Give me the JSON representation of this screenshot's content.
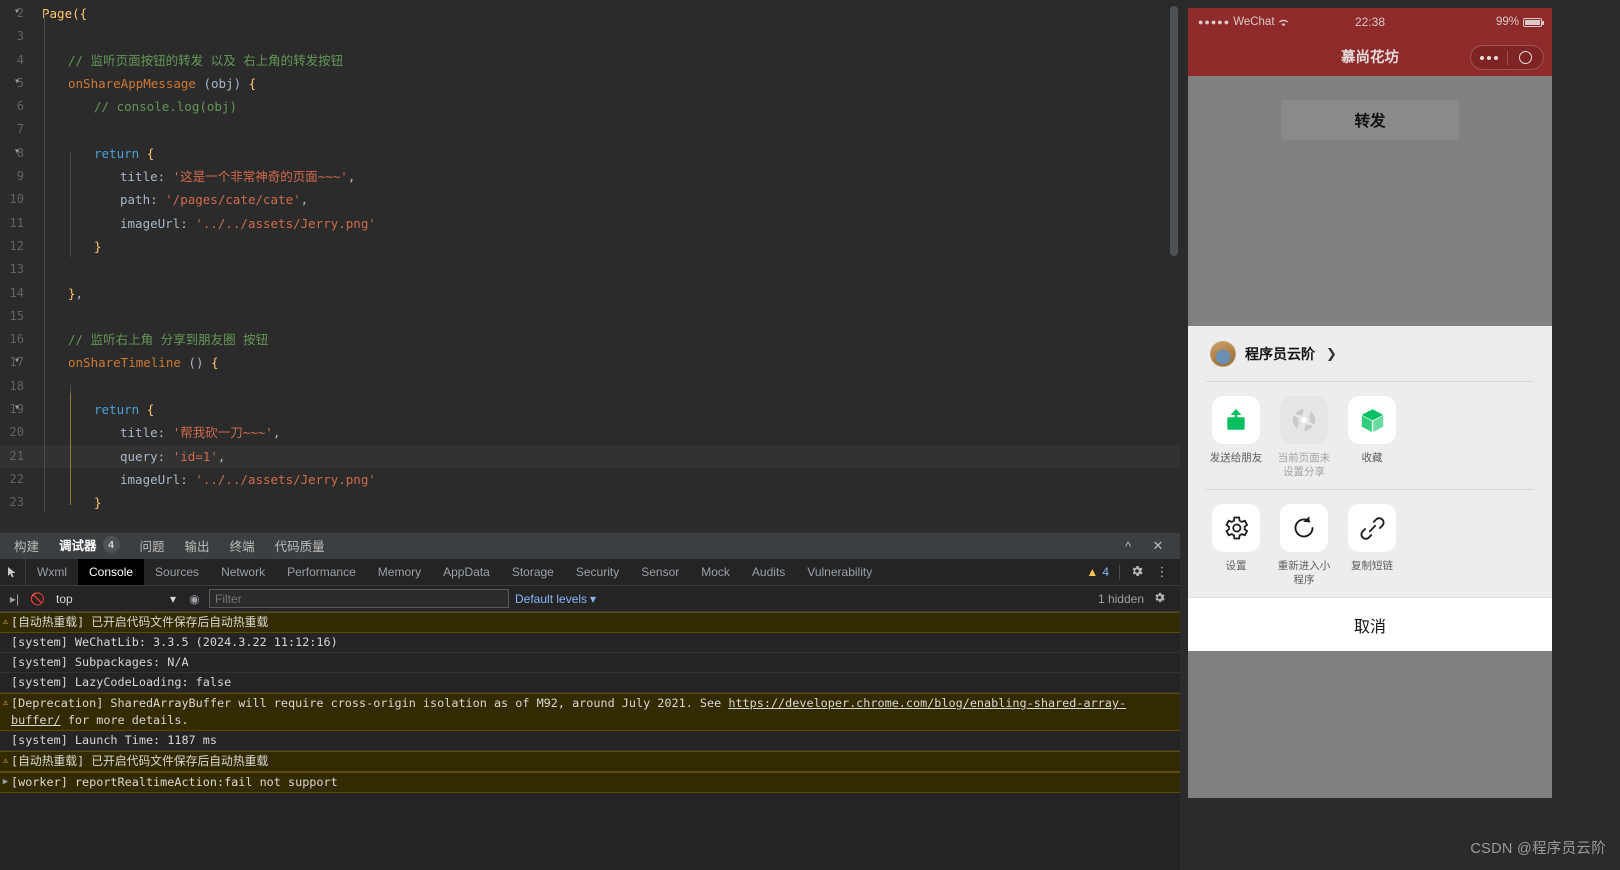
{
  "editor": {
    "lines": [
      {
        "num": "2",
        "fold": true,
        "indent": 0,
        "tokens": [
          {
            "t": "Page",
            "c": "k-fn"
          },
          {
            "t": "(",
            "c": "k-brace"
          },
          {
            "t": "{",
            "c": "k-brace"
          }
        ]
      },
      {
        "num": "3",
        "fold": false,
        "indent": 0,
        "tokens": []
      },
      {
        "num": "4",
        "fold": false,
        "indent": 1,
        "tokens": [
          {
            "t": "// 监听页面按钮的转发 以及 右上角的转发按钮",
            "c": "k-cm"
          }
        ]
      },
      {
        "num": "5",
        "fold": true,
        "indent": 1,
        "tokens": [
          {
            "t": "onShareAppMessage ",
            "c": "k-fnn"
          },
          {
            "t": "(",
            "c": "k-pun"
          },
          {
            "t": "obj",
            "c": "k-param"
          },
          {
            "t": ") ",
            "c": "k-pun"
          },
          {
            "t": "{",
            "c": "k-brace"
          }
        ]
      },
      {
        "num": "6",
        "fold": false,
        "indent": 2,
        "tokens": [
          {
            "t": "// console.log(obj)",
            "c": "k-cm"
          }
        ]
      },
      {
        "num": "7",
        "fold": false,
        "indent": 0,
        "tokens": []
      },
      {
        "num": "8",
        "fold": true,
        "indent": 2,
        "tokens": [
          {
            "t": "return ",
            "c": "k-ret"
          },
          {
            "t": "{",
            "c": "k-brace"
          }
        ]
      },
      {
        "num": "9",
        "fold": false,
        "indent": 3,
        "tokens": [
          {
            "t": "title: ",
            "c": "k-prop"
          },
          {
            "t": "'这是一个非常神奇的页面~~~'",
            "c": "k-str"
          },
          {
            "t": ",",
            "c": "k-pun"
          }
        ]
      },
      {
        "num": "10",
        "fold": false,
        "indent": 3,
        "tokens": [
          {
            "t": "path: ",
            "c": "k-prop"
          },
          {
            "t": "'/pages/cate/cate'",
            "c": "k-str"
          },
          {
            "t": ",",
            "c": "k-pun"
          }
        ]
      },
      {
        "num": "11",
        "fold": false,
        "indent": 3,
        "tokens": [
          {
            "t": "imageUrl: ",
            "c": "k-prop"
          },
          {
            "t": "'../../assets/Jerry.png'",
            "c": "k-str"
          }
        ]
      },
      {
        "num": "12",
        "fold": false,
        "indent": 2,
        "tokens": [
          {
            "t": "}",
            "c": "k-brace"
          }
        ]
      },
      {
        "num": "13",
        "fold": false,
        "indent": 0,
        "tokens": []
      },
      {
        "num": "14",
        "fold": false,
        "indent": 1,
        "tokens": [
          {
            "t": "}",
            "c": "k-brace"
          },
          {
            "t": ",",
            "c": "k-pun"
          }
        ]
      },
      {
        "num": "15",
        "fold": false,
        "indent": 0,
        "tokens": []
      },
      {
        "num": "16",
        "fold": false,
        "indent": 1,
        "tokens": [
          {
            "t": "// 监听右上角 分享到朋友圈 按钮",
            "c": "k-cm"
          }
        ]
      },
      {
        "num": "17",
        "fold": true,
        "indent": 1,
        "tokens": [
          {
            "t": "onShareTimeline ",
            "c": "k-fnn"
          },
          {
            "t": "() ",
            "c": "k-pun"
          },
          {
            "t": "{",
            "c": "k-brace"
          }
        ]
      },
      {
        "num": "18",
        "fold": false,
        "indent": 0,
        "tokens": []
      },
      {
        "num": "19",
        "fold": true,
        "indent": 2,
        "tokens": [
          {
            "t": "return ",
            "c": "k-ret"
          },
          {
            "t": "{",
            "c": "k-brace"
          }
        ]
      },
      {
        "num": "20",
        "fold": false,
        "indent": 3,
        "tokens": [
          {
            "t": "title: ",
            "c": "k-prop"
          },
          {
            "t": "'帮我砍一刀~~~'",
            "c": "k-str"
          },
          {
            "t": ",",
            "c": "k-pun"
          }
        ]
      },
      {
        "num": "21",
        "fold": false,
        "indent": 3,
        "highlight": true,
        "tokens": [
          {
            "t": "query: ",
            "c": "k-prop"
          },
          {
            "t": "'id=1'",
            "c": "k-str"
          },
          {
            "t": ",",
            "c": "k-pun"
          }
        ]
      },
      {
        "num": "22",
        "fold": false,
        "indent": 3,
        "tokens": [
          {
            "t": "imageUrl: ",
            "c": "k-prop"
          },
          {
            "t": "'../../assets/Jerry.png'",
            "c": "k-str"
          }
        ]
      },
      {
        "num": "23",
        "fold": false,
        "indent": 2,
        "tokens": [
          {
            "t": "}",
            "c": "k-brace"
          }
        ]
      }
    ]
  },
  "ide_tabs": {
    "items": [
      {
        "label": "构建",
        "badge": "",
        "active": false
      },
      {
        "label": "调试器",
        "badge": "4",
        "active": true
      },
      {
        "label": "问题",
        "badge": "",
        "active": false
      },
      {
        "label": "输出",
        "badge": "",
        "active": false
      },
      {
        "label": "终端",
        "badge": "",
        "active": false
      },
      {
        "label": "代码质量",
        "badge": "",
        "active": false
      }
    ],
    "collapse_icon": "chevron-up",
    "close_icon": "×"
  },
  "devtools": {
    "tabs": [
      {
        "label": "Wxml",
        "active": false
      },
      {
        "label": "Console",
        "active": true
      },
      {
        "label": "Sources",
        "active": false
      },
      {
        "label": "Network",
        "active": false
      },
      {
        "label": "Performance",
        "active": false
      },
      {
        "label": "Memory",
        "active": false
      },
      {
        "label": "AppData",
        "active": false
      },
      {
        "label": "Storage",
        "active": false
      },
      {
        "label": "Security",
        "active": false
      },
      {
        "label": "Sensor",
        "active": false
      },
      {
        "label": "Mock",
        "active": false
      },
      {
        "label": "Audits",
        "active": false
      },
      {
        "label": "Vulnerability",
        "active": false
      }
    ],
    "warning_count": "4",
    "filterbar": {
      "context": "top",
      "filter_placeholder": "Filter",
      "filter_value": "",
      "levels": "Default levels",
      "hidden_count": "1 hidden"
    },
    "logs": [
      {
        "level": "warn",
        "expandable": false,
        "parts": [
          {
            "text": "[自动热重载] 已开启代码文件保存后自动热重载",
            "link": false
          }
        ]
      },
      {
        "level": "info",
        "expandable": false,
        "parts": [
          {
            "text": "[system] WeChatLib: 3.3.5 (2024.3.22 11:12:16)",
            "link": false
          }
        ]
      },
      {
        "level": "info",
        "expandable": false,
        "parts": [
          {
            "text": "[system] Subpackages: N/A",
            "link": false
          }
        ]
      },
      {
        "level": "info",
        "expandable": false,
        "parts": [
          {
            "text": "[system] LazyCodeLoading: false",
            "link": false
          }
        ]
      },
      {
        "level": "warn",
        "expandable": false,
        "parts": [
          {
            "text": "[Deprecation] SharedArrayBuffer will require cross-origin isolation as of M92, around July 2021. See ",
            "link": false
          },
          {
            "text": "https://developer.chrome.com/blog/enabling-shared-array-buffer/",
            "link": true
          },
          {
            "text": " for more details.",
            "link": false
          }
        ]
      },
      {
        "level": "info",
        "expandable": false,
        "parts": [
          {
            "text": "[system] Launch Time: 1187 ms",
            "link": false
          }
        ]
      },
      {
        "level": "warn",
        "expandable": false,
        "parts": [
          {
            "text": "[自动热重载] 已开启代码文件保存后自动热重载",
            "link": false
          }
        ]
      },
      {
        "level": "warn",
        "expandable": true,
        "parts": [
          {
            "text": "[worker] reportRealtimeAction:fail not support",
            "link": false
          }
        ]
      }
    ]
  },
  "simulator": {
    "statusbar": {
      "carrier": "WeChat",
      "signal_dots": "●●●●●",
      "wifi_icon": "wifi-icon",
      "time": "22:38",
      "battery": "99%"
    },
    "navbar": {
      "title": "慕尚花坊"
    },
    "page": {
      "share_button": "转发"
    },
    "sheet": {
      "user_name": "程序员云阶",
      "row1": [
        {
          "label": "发送给朋友",
          "icon": "share-upload-icon",
          "dim": false,
          "color": "#07c160"
        },
        {
          "label": "当前页面未设置分享",
          "icon": "aperture-icon",
          "dim": true,
          "color": "#c9c9c9"
        },
        {
          "label": "收藏",
          "icon": "cube-icon",
          "dim": false,
          "color": "#07c160"
        }
      ],
      "row2": [
        {
          "label": "设置",
          "icon": "gear-icon",
          "dim": false,
          "color": "#1a1a1a"
        },
        {
          "label": "重新进入小程序",
          "icon": "refresh-icon",
          "dim": false,
          "color": "#1a1a1a"
        },
        {
          "label": "复制短链",
          "icon": "link-icon",
          "dim": false,
          "color": "#1a1a1a"
        }
      ],
      "cancel": "取消"
    }
  },
  "watermark": {
    "text": "CSDN @程序员云阶"
  }
}
